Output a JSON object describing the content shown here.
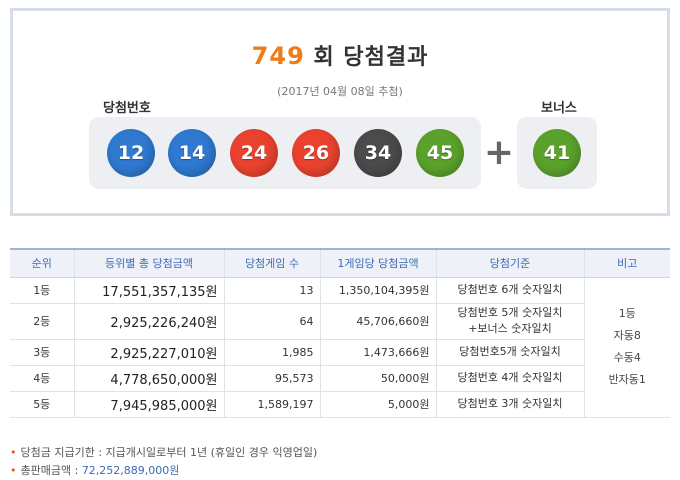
{
  "header": {
    "round_number": "749",
    "round_suffix": "회 당첨결과",
    "draw_date": "(2017년 04월 08일 추첨)",
    "winning_label": "당첨번호",
    "bonus_label": "보너스"
  },
  "balls": [
    {
      "number": "12",
      "color": "#2f79d0"
    },
    {
      "number": "14",
      "color": "#2f79d0"
    },
    {
      "number": "24",
      "color": "#e9432f"
    },
    {
      "number": "26",
      "color": "#e9432f"
    },
    {
      "number": "34",
      "color": "#4b4b4b"
    },
    {
      "number": "45",
      "color": "#5ba22c"
    }
  ],
  "plus_symbol": "+",
  "bonus_ball": {
    "number": "41",
    "color": "#5ba22c"
  },
  "table": {
    "headers": [
      "순위",
      "등위별 총 당첨금액",
      "당첨게임 수",
      "1게임당 당첨금액",
      "당첨기준",
      "비고"
    ],
    "rows": [
      {
        "rank": "1등",
        "total": "17,551,357,135원",
        "games": "13",
        "per_game": "1,350,104,395원",
        "criteria": [
          "당첨번호 6개 숫자일치"
        ]
      },
      {
        "rank": "2등",
        "total": "2,925,226,240원",
        "games": "64",
        "per_game": "45,706,660원",
        "criteria": [
          "당첨번호 5개 숫자일치",
          "+보너스 숫자일치"
        ]
      },
      {
        "rank": "3등",
        "total": "2,925,227,010원",
        "games": "1,985",
        "per_game": "1,473,666원",
        "criteria": [
          "당첨번호5개 숫자일치"
        ]
      },
      {
        "rank": "4등",
        "total": "4,778,650,000원",
        "games": "95,573",
        "per_game": "50,000원",
        "criteria": [
          "당첨번호 4개 숫자일치"
        ]
      },
      {
        "rank": "5등",
        "total": "7,945,985,000원",
        "games": "1,589,197",
        "per_game": "5,000원",
        "criteria": [
          "당첨번호 3개 숫자일치"
        ]
      }
    ],
    "note_lines": [
      "1등",
      "자동8",
      "수동4",
      "반자동1"
    ]
  },
  "footer": {
    "bullet": "•",
    "claim_text": "당첨금 지급기한 : 지급개시일로부터 1년 (휴일인 경우 익영업일)",
    "sales_label": "총판매금액 : ",
    "sales_value": "72,252,889,000원"
  }
}
